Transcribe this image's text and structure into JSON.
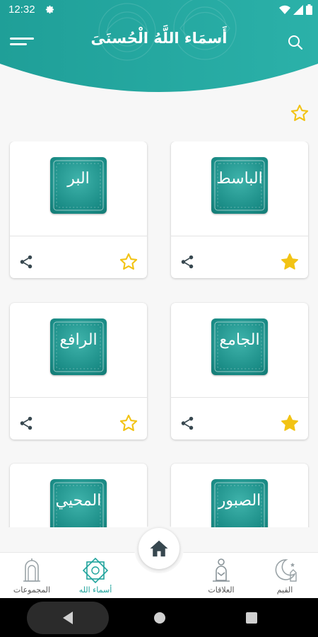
{
  "status_bar": {
    "time": "12:32"
  },
  "header": {
    "title": "أَسمَاء اللَّهُ الْحُسنَىَ"
  },
  "cards": [
    {
      "name": "الباسط",
      "favorite": true
    },
    {
      "name": "البر",
      "favorite": false
    },
    {
      "name": "الجامع",
      "favorite": true
    },
    {
      "name": "الرافع",
      "favorite": false
    },
    {
      "name": "الصبور",
      "favorite": false
    },
    {
      "name": "المحيي",
      "favorite": false
    }
  ],
  "bottom_nav": {
    "items": [
      {
        "label": "القيم",
        "icon": "crescent-mosque-icon"
      },
      {
        "label": "العلاقات",
        "icon": "praying-person-icon"
      },
      {
        "label": "أسماء الله",
        "icon": "islamic-star-icon",
        "active": true
      },
      {
        "label": "المجموعات",
        "icon": "mosque-door-icon"
      }
    ]
  },
  "colors": {
    "primary": "#1fa39c",
    "star": "#f2c314",
    "share": "#37474f"
  }
}
